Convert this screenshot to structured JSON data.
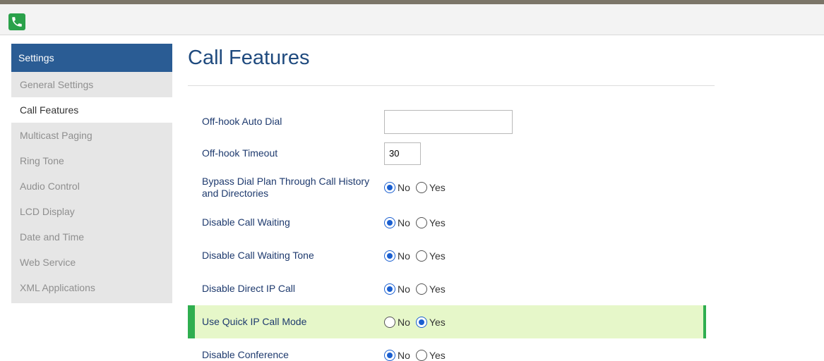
{
  "sidebar": {
    "title": "Settings",
    "items": [
      {
        "label": "General Settings",
        "active": false
      },
      {
        "label": "Call Features",
        "active": true
      },
      {
        "label": "Multicast Paging",
        "active": false
      },
      {
        "label": "Ring Tone",
        "active": false
      },
      {
        "label": "Audio Control",
        "active": false
      },
      {
        "label": "LCD Display",
        "active": false
      },
      {
        "label": "Date and Time",
        "active": false
      },
      {
        "label": "Web Service",
        "active": false
      },
      {
        "label": "XML Applications",
        "active": false
      }
    ]
  },
  "main": {
    "title": "Call Features",
    "fields": {
      "offhook_auto_dial": {
        "label": "Off-hook Auto Dial",
        "value": ""
      },
      "offhook_timeout": {
        "label": "Off-hook Timeout",
        "value": "30"
      },
      "bypass_dial_plan": {
        "label": "Bypass Dial Plan Through Call History and Directories",
        "selected": "No"
      },
      "disable_call_waiting": {
        "label": "Disable Call Waiting",
        "selected": "No"
      },
      "disable_call_waiting_tone": {
        "label": "Disable Call Waiting Tone",
        "selected": "No"
      },
      "disable_direct_ip_call": {
        "label": "Disable Direct IP Call",
        "selected": "No"
      },
      "use_quick_ip_call_mode": {
        "label": "Use Quick IP Call Mode",
        "selected": "Yes"
      },
      "disable_conference": {
        "label": "Disable Conference",
        "selected": "No"
      }
    },
    "options": {
      "no": "No",
      "yes": "Yes"
    }
  },
  "colors": {
    "sidebar_header": "#2a5c94",
    "title": "#1f4a7e",
    "highlight_bg": "#e6f7c9",
    "highlight_accent": "#2fae4f",
    "radio_checked": "#1a5fd0"
  },
  "icons": {
    "logo": "phone-icon"
  }
}
